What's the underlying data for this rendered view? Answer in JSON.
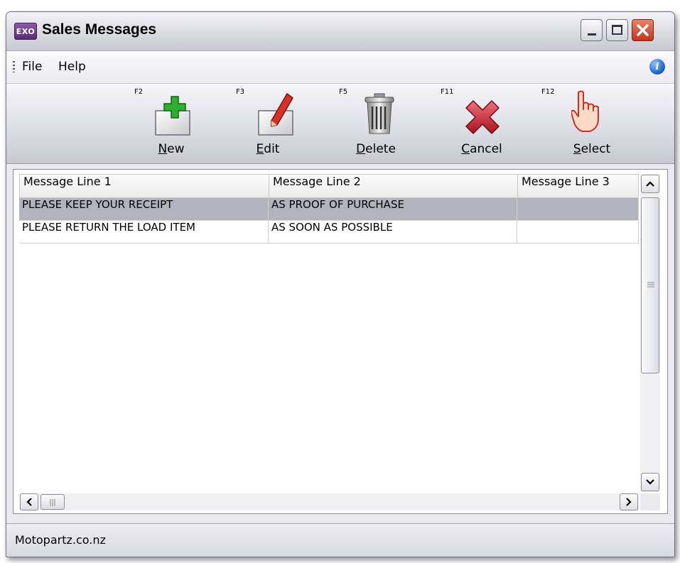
{
  "window": {
    "icon_text": "EXO",
    "title": "Sales Messages"
  },
  "menu": {
    "file": "File",
    "help": "Help"
  },
  "toolbar": {
    "new": {
      "key": "F2",
      "label": "New"
    },
    "edit": {
      "key": "F3",
      "label": "Edit"
    },
    "delete": {
      "key": "F5",
      "label": "Delete"
    },
    "cancel": {
      "key": "F11",
      "label": "Cancel"
    },
    "select": {
      "key": "F12",
      "label": "Select"
    }
  },
  "grid": {
    "columns": [
      "Message Line 1",
      "Message Line 2",
      "Message Line 3"
    ],
    "rows": [
      [
        "PLEASE KEEP YOUR RECEIPT",
        "AS PROOF OF PURCHASE",
        ""
      ],
      [
        "PLEASE RETURN THE LOAD ITEM",
        "AS SOON AS POSSIBLE",
        ""
      ]
    ],
    "selected_row": 0
  },
  "status": {
    "text": "Motopartz.co.nz"
  },
  "icons": {
    "app": "exo-app-icon",
    "new": "plus-page-icon",
    "edit": "pencil-page-icon",
    "delete": "trash-can-icon",
    "cancel": "red-x-icon",
    "select": "pointing-hand-icon",
    "info": "info-icon"
  },
  "colors": {
    "selected_row": "#b1b3bd",
    "close_button": "#c0361c"
  }
}
